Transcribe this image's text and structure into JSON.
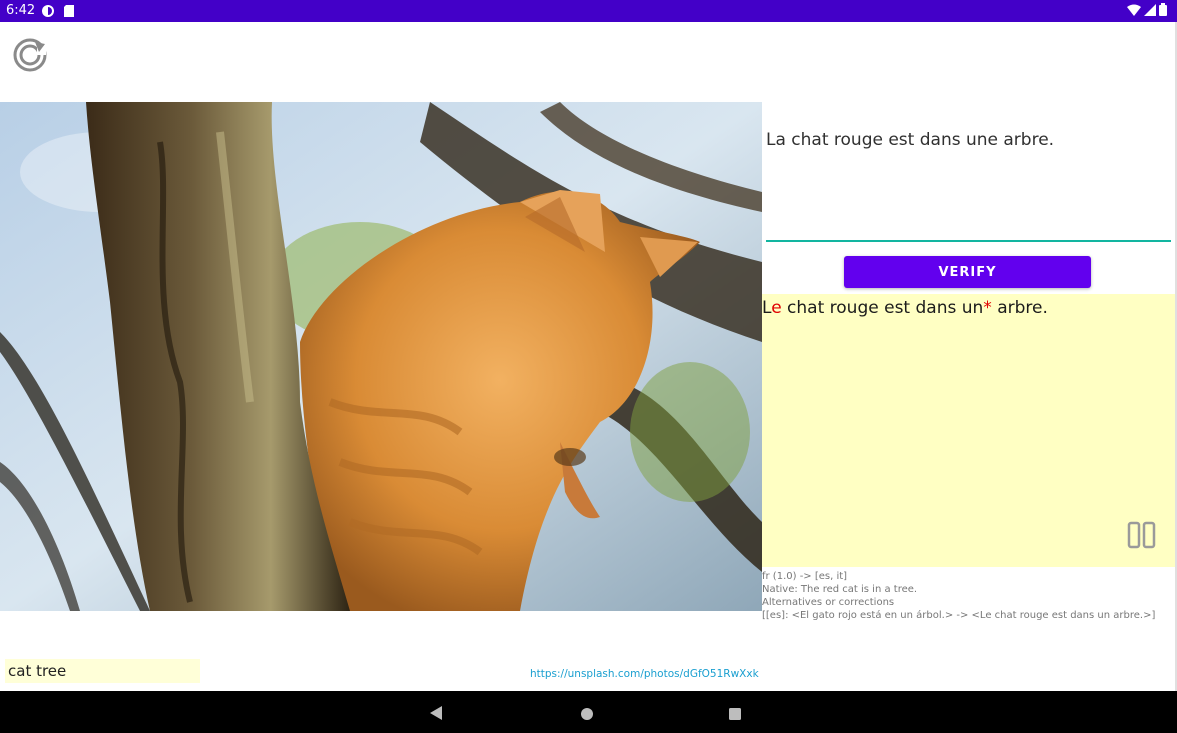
{
  "status_bar": {
    "time": "6:42",
    "icons": [
      "data-saver-icon",
      "sd-card-icon"
    ],
    "right_icons": [
      "wifi-icon",
      "signal-icon",
      "battery-icon"
    ]
  },
  "toolbar": {
    "refresh_icon": "refresh-icon"
  },
  "photo": {
    "subject": "orange-cat-in-tree-image"
  },
  "editor": {
    "value": "La chat rouge est dans une arbre."
  },
  "verify_button": {
    "label": "VERIFY"
  },
  "result": {
    "segments": [
      {
        "text": "L",
        "error": false
      },
      {
        "text": "e",
        "error": true
      },
      {
        "text": " chat rouge est dans un",
        "error": false
      },
      {
        "text": "*",
        "error": true
      },
      {
        "text": " arbre.",
        "error": false
      }
    ]
  },
  "info": {
    "line1": "fr (1.0) -> [es, it]",
    "line2": "Native: The red cat is in a tree.",
    "line3": "Alternatives or corrections",
    "line4": "[[es]: <El gato rojo está en un árbol.> -> <Le chat rouge est dans un arbre.>]"
  },
  "tag": {
    "label": "cat tree"
  },
  "source": {
    "url": "https://unsplash.com/photos/dGfO51RwXxk"
  },
  "colors": {
    "status_bar": "#4300c8",
    "accent": "#6200ee",
    "underline": "#12b5a0",
    "result_bg": "#ffffc3",
    "error": "#e00000",
    "link": "#1a9fd0"
  }
}
